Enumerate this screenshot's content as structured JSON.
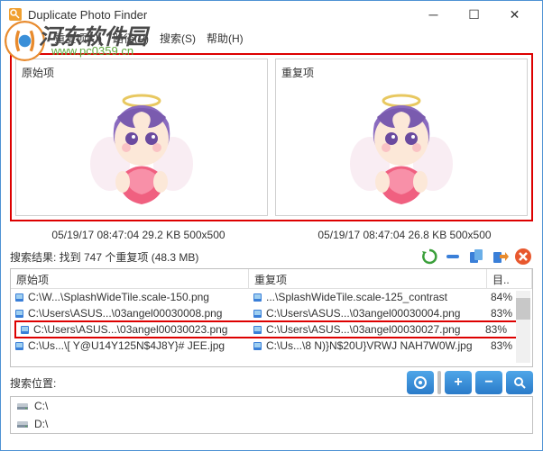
{
  "window": {
    "title": "Duplicate Photo Finder"
  },
  "menu": {
    "file": "文件(F)",
    "dup": "重复项(U)",
    "path": "路径(P)",
    "search": "搜索(S)",
    "help": "帮助(H)"
  },
  "watermark": {
    "text": "河东软件园",
    "url": "www.pc0359.cn"
  },
  "preview": {
    "original_label": "原始项",
    "duplicate_label": "重复项",
    "original_info": "05/19/17 08:47:04  29.2 KB  500x500",
    "duplicate_info": "05/19/17 08:47:04  26.8 KB  500x500"
  },
  "results": {
    "header": "搜索结果: 找到 747 个重复项 (48.3 MB)",
    "col_original": "原始项",
    "col_dup": "重复项",
    "col_match": "目..",
    "rows": [
      {
        "o": "C:\\W...\\SplashWideTile.scale-150.png",
        "d": "...\\SplashWideTile.scale-125_contrast",
        "m": "84%"
      },
      {
        "o": "C:\\Users\\ASUS...\\03angel00030008.png",
        "d": "C:\\Users\\ASUS...\\03angel00030004.png",
        "m": "83%"
      },
      {
        "o": "C:\\Users\\ASUS...\\03angel00030023.png",
        "d": "C:\\Users\\ASUS...\\03angel00030027.png",
        "m": "83%"
      },
      {
        "o": "C:\\Us...\\[ Y@U14Y125N$4J8Y}# JEE.jpg",
        "d": "C:\\Us...\\8 N)}N$20U}VRWJ NAH7W0W.jpg",
        "m": "83%"
      }
    ]
  },
  "locations": {
    "header": "搜索位置:",
    "drives": [
      "C:\\",
      "D:\\"
    ]
  }
}
